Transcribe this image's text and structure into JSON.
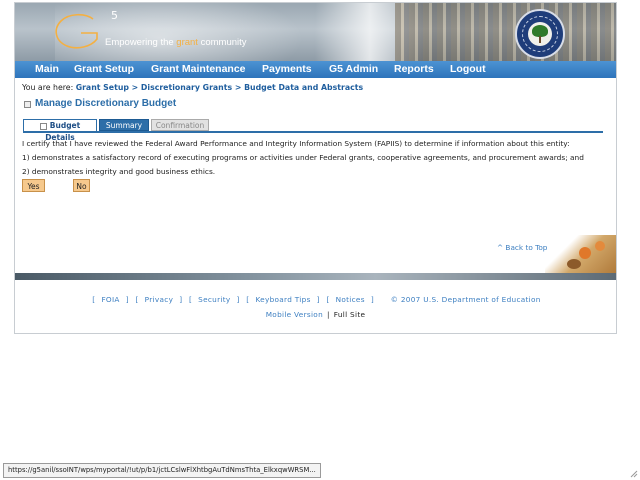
{
  "header": {
    "logo_text": "G",
    "logo_sup": "5",
    "tagline_pre": "Empowering the ",
    "tagline_hl": "grant",
    "tagline_post": " community",
    "seal_text": "DEPARTMENT OF EDUCATION"
  },
  "nav": {
    "items": [
      {
        "label": "Main"
      },
      {
        "label": "Grant Setup"
      },
      {
        "label": "Grant Maintenance"
      },
      {
        "label": "Payments"
      },
      {
        "label": "G5 Admin"
      },
      {
        "label": "Reports"
      },
      {
        "label": "Logout"
      }
    ]
  },
  "breadcrumb": {
    "prefix": "You are here: ",
    "items": [
      "Grant Setup",
      "Discretionary Grants",
      "Budget Data and Abstracts"
    ],
    "separator": " > "
  },
  "page_title": "Manage Discretionary Budget",
  "tabs": [
    {
      "label": "Budget Details",
      "state": "active"
    },
    {
      "label": "Summary",
      "state": "enabled"
    },
    {
      "label": "Confirmation",
      "state": "disabled"
    }
  ],
  "certification": {
    "line1": "I certify that I have reviewed the Federal Award Performance and Integrity Information System (FAPIIS) to determine if information about this entity:",
    "line2": "1) demonstrates a satisfactory record of executing programs or activities under Federal grants, cooperative agreements, and procurement awards; and",
    "line3": "2) demonstrates integrity and good business ethics.",
    "yes_label": "Yes",
    "no_label": "No"
  },
  "back_to_top": "^ Back to Top",
  "footer": {
    "links": [
      "FOIA",
      "Privacy",
      "Security",
      "Keyboard Tips",
      "Notices"
    ],
    "copyright": "© 2007 U.S. Department of Education",
    "mobile_label": "Mobile Version",
    "separator": "|",
    "full_label": "Full Site"
  },
  "status_bar_url": "https://g5anil/ssoINT/wps/myportal/!ut/p/b1/jctLCslwFlXhtbgAuTdNmsThta_ElkxqwWRSM...",
  "colors": {
    "nav_bg": "#2d74bb",
    "title": "#2d6ea8",
    "link": "#3d7fc1",
    "button_bg": "#f6c98d",
    "tagline_accent": "#f4b042"
  }
}
